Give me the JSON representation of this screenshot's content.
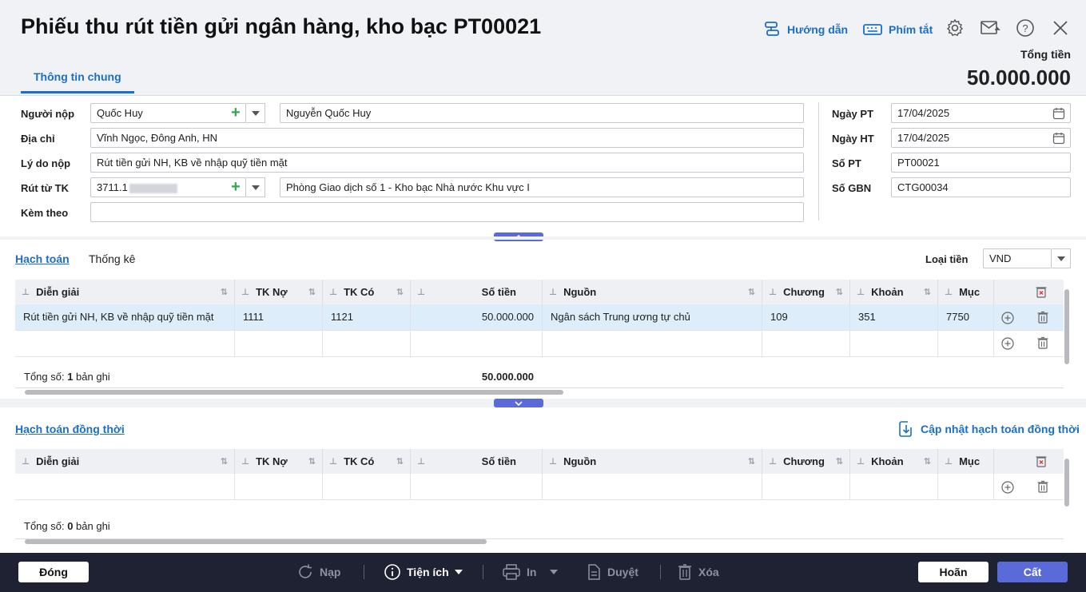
{
  "header": {
    "title": "Phiếu thu rút tiền gửi ngân hàng, kho bạc PT00021",
    "guide_label": "Hướng dẫn",
    "shortcut_label": "Phím tắt",
    "total_label": "Tổng tiền",
    "total_value": "50.000.000",
    "tab_general": "Thông tin chung"
  },
  "form": {
    "payer_label": "Người nộp",
    "payer_code": "Quốc Huy",
    "payer_name": "Nguyễn Quốc Huy",
    "address_label": "Địa chỉ",
    "address": "Vĩnh Ngọc, Đông Anh, HN",
    "reason_label": "Lý do nộp",
    "reason": "Rút tiền gửi NH, KB về nhập quỹ tiền mặt",
    "account_label": "Rút từ TK",
    "account_no": "3711.1",
    "account_bank": "Phòng Giao dịch số 1 - Kho bạc Nhà nước Khu vực I",
    "attach_label": "Kèm theo",
    "attach": "",
    "date_pt_label": "Ngày PT",
    "date_pt": "17/04/2025",
    "date_ht_label": "Ngày HT",
    "date_ht": "17/04/2025",
    "so_pt_label": "Số PT",
    "so_pt": "PT00021",
    "so_gbn_label": "Số GBN",
    "so_gbn": "CTG00034"
  },
  "section1": {
    "tab_accounting": "Hạch toán",
    "tab_stats": "Thống kê",
    "currency_label": "Loại tiền",
    "currency": "VND",
    "columns": [
      "Diễn giải",
      "TK Nợ",
      "TK Có",
      "Số tiền",
      "Nguồn",
      "Chương",
      "Khoản",
      "Mục"
    ],
    "rows": [
      [
        "Rút tiền gửi NH, KB về nhập quỹ tiền mặt",
        "1111",
        "1121",
        "50.000.000",
        "Ngân sách Trung ương tự chủ",
        "109",
        "351",
        "7750"
      ]
    ],
    "total_prefix": "Tổng số: ",
    "total_count": "1",
    "total_suffix": " bản ghi",
    "total_amount": "50.000.000"
  },
  "section2": {
    "title": "Hạch toán đồng thời",
    "update_label": "Cập nhật hạch toán đồng thời",
    "columns": [
      "Diễn giải",
      "TK Nợ",
      "TK Có",
      "Số tiền",
      "Nguồn",
      "Chương",
      "Khoản",
      "Mục"
    ],
    "total_prefix": "Tổng số: ",
    "total_count": "0",
    "total_suffix": " bản ghi"
  },
  "footer": {
    "close": "Đóng",
    "reload": "Nạp",
    "utility": "Tiện ích",
    "print": "In",
    "approve": "Duyệt",
    "delete": "Xóa",
    "cancel": "Hoãn",
    "save": "Cất"
  },
  "colors": {
    "accent": "#1b6fc6",
    "save_button": "#5a6bd9",
    "footer_bg": "#1e2233",
    "selected_row": "#ddeefa"
  }
}
